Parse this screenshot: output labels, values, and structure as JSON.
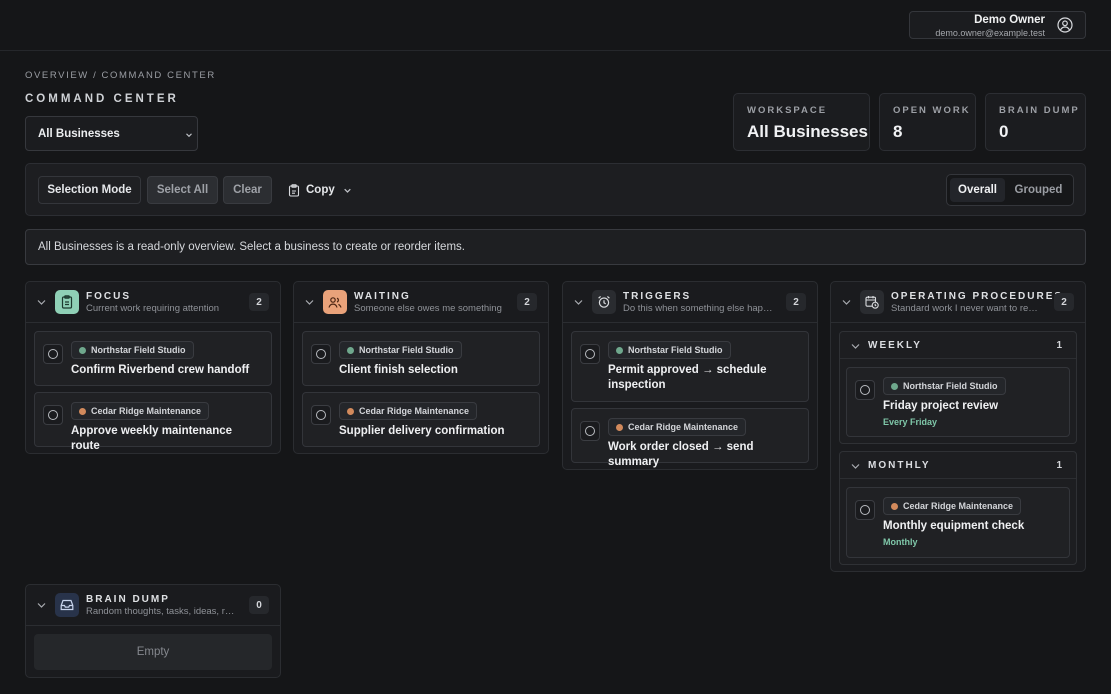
{
  "user": {
    "name": "Demo Owner",
    "email": "demo.owner@example.test",
    "icon": "user-circle-icon"
  },
  "breadcrumb": "OVERVIEW / COMMAND CENTER",
  "page_title": "COMMAND CENTER",
  "business_select": {
    "value": "All Businesses"
  },
  "stats": [
    {
      "label": "WORKSPACE",
      "value": "All Businesses"
    },
    {
      "label": "OPEN WORK",
      "value": "8"
    },
    {
      "label": "BRAIN DUMP",
      "value": "0"
    }
  ],
  "toolbar": {
    "selection_mode": "Selection Mode",
    "select_all": "Select All",
    "clear": "Clear",
    "copy": "Copy",
    "view_options": [
      "Overall",
      "Grouped"
    ],
    "active_view": "Overall"
  },
  "notice": "All Businesses is a read-only overview. Select a business to create or reorder items.",
  "businesses": {
    "northstar": {
      "name": "Northstar Field Studio",
      "color": "#6fa88d"
    },
    "cedar": {
      "name": "Cedar Ridge Maintenance",
      "color": "#d28a5c"
    }
  },
  "columns": {
    "focus": {
      "title": "FOCUS",
      "subtitle": "Current work requiring attention",
      "count": "2",
      "icon": "clipboard-icon",
      "accent": "#8fd0b6",
      "items": [
        {
          "business": "Northstar Field Studio",
          "title": "Confirm Riverbend crew handoff"
        },
        {
          "business": "Cedar Ridge Maintenance",
          "title": "Approve weekly maintenance route"
        }
      ]
    },
    "waiting": {
      "title": "WAITING",
      "subtitle": "Someone else owes me something",
      "count": "2",
      "icon": "people-icon",
      "accent": "#e9a27a",
      "items": [
        {
          "business": "Northstar Field Studio",
          "title": "Client finish selection"
        },
        {
          "business": "Cedar Ridge Maintenance",
          "title": "Supplier delivery confirmation"
        }
      ]
    },
    "triggers": {
      "title": "TRIGGERS",
      "subtitle": "Do this when something else hap…",
      "count": "2",
      "icon": "alarm-clock-icon",
      "accent": "#2a2c30",
      "items": [
        {
          "business": "Northstar Field Studio",
          "title": "Permit approved → schedule inspection"
        },
        {
          "business": "Cedar Ridge Maintenance",
          "title": "Work order closed → send summary"
        }
      ]
    },
    "procedures": {
      "title": "OPERATING PROCEDURES",
      "subtitle": "Standard work I never want to re…",
      "count": "2",
      "icon": "calendar-clock-icon",
      "accent": "#2a2c30",
      "groups": [
        {
          "label": "WEEKLY",
          "count": "1",
          "item": {
            "business": "Northstar Field Studio",
            "title": "Friday project review",
            "recurrence": "Every Friday"
          }
        },
        {
          "label": "MONTHLY",
          "count": "1",
          "item": {
            "business": "Cedar Ridge Maintenance",
            "title": "Monthly equipment check",
            "recurrence": "Monthly"
          }
        }
      ]
    },
    "brain_dump": {
      "title": "BRAIN DUMP",
      "subtitle": "Random thoughts, tasks, ideas, r…",
      "count": "0",
      "icon": "inbox-icon",
      "accent": "#28334a",
      "empty": "Empty"
    }
  }
}
